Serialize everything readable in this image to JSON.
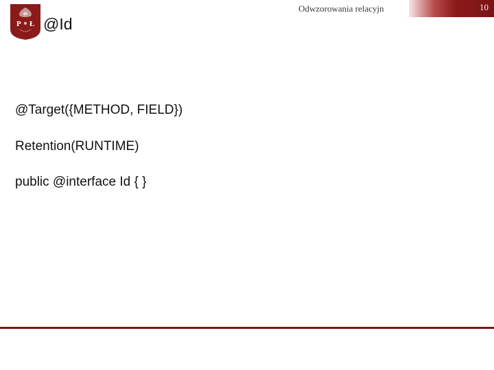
{
  "header": {
    "label": "Odwzorowania relacyjn",
    "page_number": "10"
  },
  "logo": {
    "name": "university-shield-logo",
    "letters_left": "P",
    "letters_right": "Ł",
    "shield_color": "#8b1a1a",
    "text_color": "#ffffff"
  },
  "title": "@Id",
  "body_lines": [
    "@Target({METHOD, FIELD})",
    "Retention(RUNTIME)",
    "public @interface Id { }"
  ],
  "colors": {
    "accent": "#8b1a1a",
    "rule": "#7b1616"
  }
}
